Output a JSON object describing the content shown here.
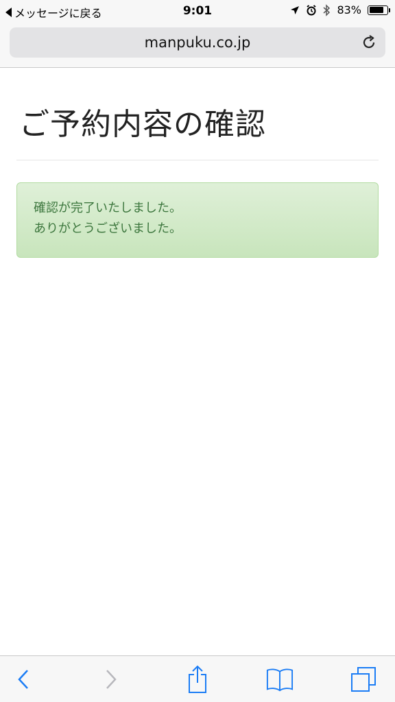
{
  "status_bar": {
    "back_label": "メッセージに戻る",
    "time": "9:01",
    "battery_percent": "83%",
    "battery_level": 0.83,
    "icons": [
      "location-arrow-icon",
      "alarm-icon",
      "bluetooth-icon",
      "battery-icon"
    ]
  },
  "browser": {
    "url": "manpuku.co.jp",
    "reload_icon": "reload-icon"
  },
  "page": {
    "title": "ご予約内容の確認",
    "alert": {
      "line1": "確認が完了いたしました。",
      "line2": "ありがとうございました。",
      "color_text": "#3c763d",
      "color_bg": "#dff0d8"
    }
  },
  "toolbar": {
    "items": [
      "back-icon",
      "forward-icon",
      "share-icon",
      "bookmarks-icon",
      "tabs-icon"
    ],
    "accent": "#1a7cf5",
    "disabled": "#b7b7bc"
  }
}
